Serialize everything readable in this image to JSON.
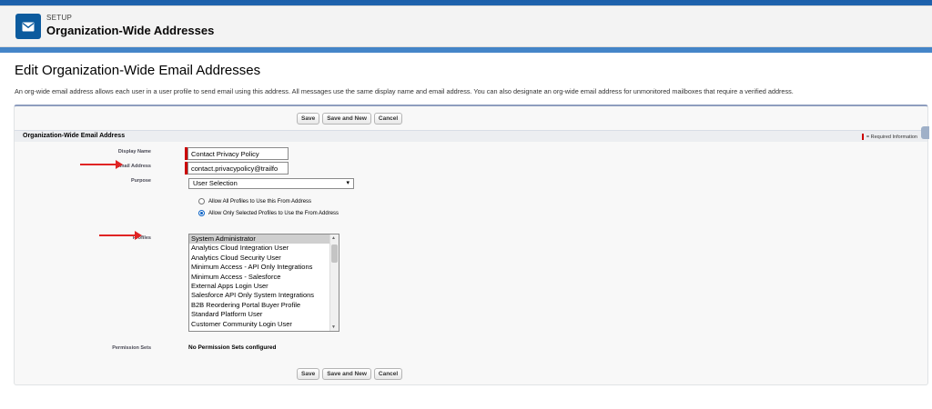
{
  "header": {
    "kicker": "SETUP",
    "title": "Organization-Wide Addresses",
    "icon": "envelope-icon"
  },
  "page": {
    "title": "Edit Organization-Wide Email Addresses",
    "description": "An org-wide email address allows each user in a user profile to send email using this address. All messages use the same display name and email address. You can also designate an org-wide email address for unmonitored mailboxes that require a verified address."
  },
  "buttons": {
    "save": "Save",
    "save_and_new": "Save and New",
    "cancel": "Cancel"
  },
  "section": {
    "title": "Organization-Wide Email Address",
    "required_legend": "= Required Information"
  },
  "form": {
    "display_name_label": "Display Name",
    "display_name_value": "Contact Privacy Policy",
    "email_label": "Email Address",
    "email_value": "contact.privacypolicy@trailfo",
    "purpose_label": "Purpose",
    "purpose_value": "User Selection",
    "radio_all": "Allow All Profiles to Use this From Address",
    "radio_selected": "Allow Only Selected Profiles to Use the From Address",
    "radio_checked": "selected",
    "profiles_label": "Profiles",
    "profiles": [
      "System Administrator",
      "Analytics Cloud Integration User",
      "Analytics Cloud Security User",
      "Minimum Access - API Only Integrations",
      "Minimum Access - Salesforce",
      "External Apps Login User",
      "Salesforce API Only System Integrations",
      "B2B Reordering Portal Buyer Profile",
      "Standard Platform User",
      "Customer Community Login User"
    ],
    "profiles_selected": "System Administrator",
    "permission_sets_label": "Permission Sets",
    "permission_sets_value": "No Permission Sets configured"
  },
  "colors": {
    "required": "#cc0000",
    "annotation_arrow": "#e02424",
    "brand": "#0c5b9e"
  }
}
